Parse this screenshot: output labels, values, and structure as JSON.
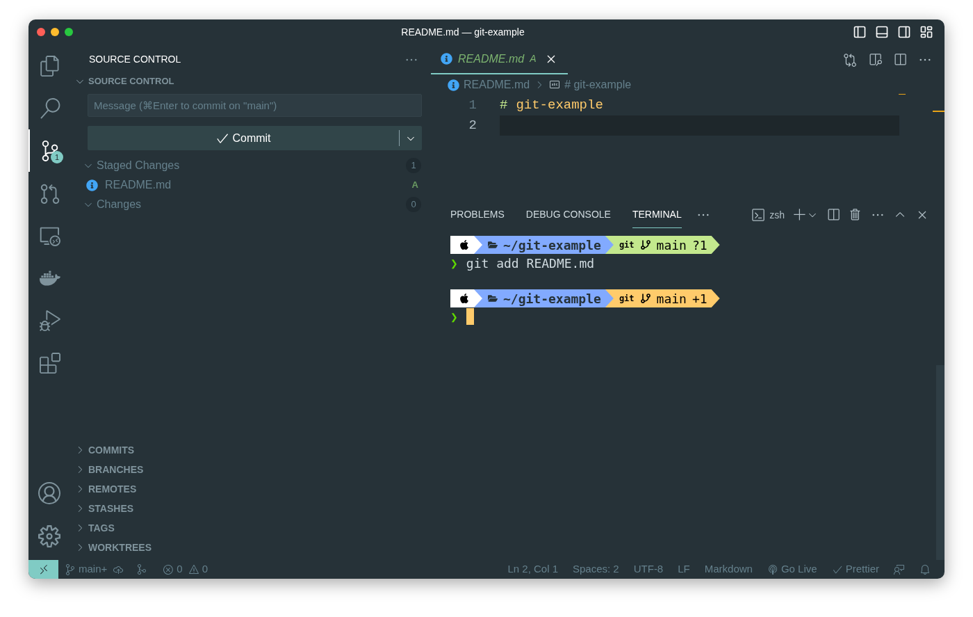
{
  "window": {
    "title": "README.md — git-example"
  },
  "activity_bar": {
    "items": [
      {
        "kind": "files",
        "selected": false
      },
      {
        "kind": "search",
        "selected": false
      },
      {
        "kind": "scm",
        "selected": true,
        "badge": "1"
      },
      {
        "kind": "pull-requests",
        "selected": false
      },
      {
        "kind": "remote",
        "selected": false
      },
      {
        "kind": "docker",
        "selected": false
      },
      {
        "kind": "debug",
        "selected": false
      },
      {
        "kind": "extensions",
        "selected": false
      }
    ],
    "bottom": [
      {
        "kind": "account"
      },
      {
        "kind": "settings"
      }
    ]
  },
  "sidebar": {
    "title": "SOURCE CONTROL",
    "section": {
      "title": "SOURCE CONTROL",
      "expanded": true
    },
    "message": {
      "placeholder": "Message (⌘Enter to commit on \"main\")"
    },
    "commit_button": "Commit",
    "groups": [
      {
        "label": "Staged Changes",
        "count": "1",
        "expanded": true,
        "children": [
          {
            "name": "README.md",
            "status": "A"
          }
        ]
      },
      {
        "label": "Changes",
        "count": "0",
        "expanded": true
      }
    ],
    "views": [
      {
        "label": "COMMITS",
        "expanded": false
      },
      {
        "label": "BRANCHES",
        "expanded": false
      },
      {
        "label": "REMOTES",
        "expanded": false
      },
      {
        "label": "STASHES",
        "expanded": false
      },
      {
        "label": "TAGS",
        "expanded": false
      },
      {
        "label": "WORKTREES",
        "expanded": false
      }
    ]
  },
  "editor": {
    "tabs": [
      {
        "label": "README.md",
        "status": "A",
        "selected": true
      }
    ],
    "breadcrumbs": [
      {
        "kind": "file",
        "label": "README.md"
      },
      {
        "kind": "symbol",
        "label": "# git-example"
      }
    ],
    "lines": [
      {
        "number": "1",
        "marker": "#",
        "text": "git-example",
        "current": false
      },
      {
        "number": "2",
        "current": true
      }
    ]
  },
  "panel": {
    "tabs": [
      {
        "label": "PROBLEMS",
        "selected": false
      },
      {
        "label": "DEBUG CONSOLE",
        "selected": false
      },
      {
        "label": "TERMINAL",
        "selected": true
      }
    ],
    "shell": "zsh",
    "terminal": [
      {
        "kind": "prompt",
        "path": "~/git-example",
        "vcs": "git",
        "branch": "main",
        "status": "?1",
        "color": "#c3e88d"
      },
      {
        "kind": "command",
        "prompt": "❯",
        "text": "git add README.md"
      },
      {
        "kind": "blank"
      },
      {
        "kind": "prompt",
        "path": "~/git-example",
        "vcs": "git",
        "branch": "main",
        "status": "+1",
        "color": "#ffcb6b"
      },
      {
        "kind": "input",
        "prompt": "❯",
        "cursor": true
      }
    ]
  },
  "status_bar": {
    "branch": "main+",
    "errors": "0",
    "warnings": "0",
    "items": [
      "Ln 2, Col 1",
      "Spaces: 2",
      "UTF-8",
      "LF",
      "Markdown"
    ],
    "go_live": "Go Live",
    "prettier": "Prettier"
  }
}
